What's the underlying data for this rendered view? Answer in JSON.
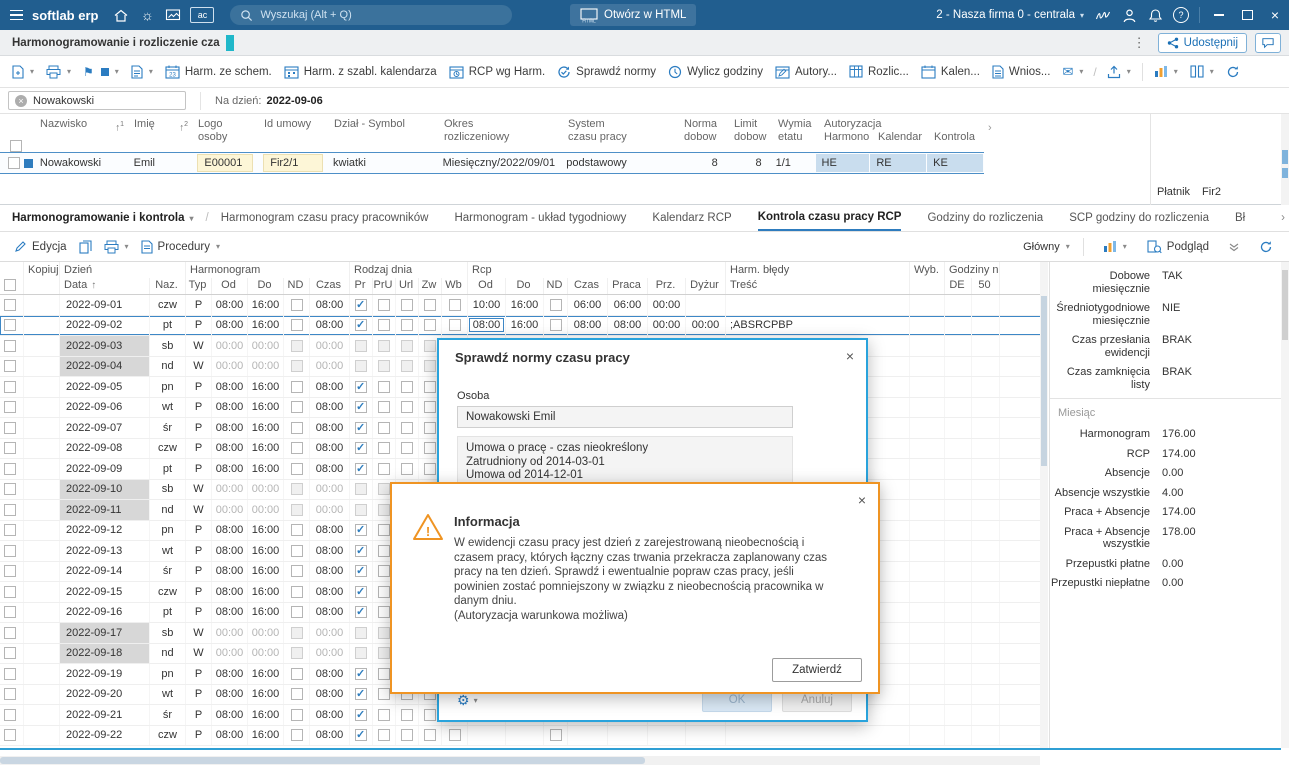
{
  "colors": {
    "accent_blue": "#2e7cbe",
    "topbar_blue": "#215e8f",
    "tab_marker_teal": "#1fb7c9",
    "dialog_orange": "#ef9423",
    "dialog_blue": "#29a3dc",
    "cell_yellow": "#fdf6d7",
    "cell_auth_blue": "#c9ddee"
  },
  "topbar": {
    "brand": "softlab erp",
    "search_placeholder": "Wyszukaj (Alt + Q)",
    "open_html": "Otwórz w HTML",
    "html_badge": "HTML",
    "company": "2 - Nasza firma 0 - centrala",
    "ac_badge": "ac"
  },
  "tabbar": {
    "tab": "Harmonogramowanie i rozliczenie cza",
    "share": "Udostępnij"
  },
  "toolbar": {
    "calendar_day": "23",
    "items": [
      {
        "label": "Harm. ze schem."
      },
      {
        "label": "Harm. z szabl. kalendarza"
      },
      {
        "label": "RCP wg Harm."
      },
      {
        "label": "Sprawdź normy"
      },
      {
        "label": "Wylicz godziny"
      },
      {
        "label": "Autory..."
      },
      {
        "label": "Rozlic..."
      },
      {
        "label": "Kalen..."
      },
      {
        "label": "Wnios..."
      }
    ]
  },
  "filters": {
    "chip": "Nowakowski",
    "date_label": "Na dzień:",
    "date_value": "2022-09-06"
  },
  "employee_table": {
    "headers": [
      {
        "l1": "Nazwisko",
        "l2": ""
      },
      {
        "l1": "Imię",
        "l2": ""
      },
      {
        "l1": "Logo",
        "l2": "osoby"
      },
      {
        "l1": "Id umowy",
        "l2": ""
      },
      {
        "l1": "Dział - Symbol",
        "l2": ""
      },
      {
        "l1": "Okres",
        "l2": "rozliczeniowy"
      },
      {
        "l1": "System",
        "l2": "czasu pracy"
      },
      {
        "l1": "Norma",
        "l2": "dobow"
      },
      {
        "l1": "Limit",
        "l2": "dobow"
      },
      {
        "l1": "Wymia",
        "l2": "etatu"
      },
      {
        "l1": "Autoryzacja",
        "l2": ""
      }
    ],
    "auth_subheaders": [
      "Harmono",
      "Kalendar",
      "Kontrola"
    ],
    "sort_indicators": [
      "1",
      "2"
    ],
    "row": {
      "nazwisko": "Nowakowski",
      "imie": "Emil",
      "logo": "E00001",
      "id_umowy": "Fir2/1",
      "dzial": "kwiatki",
      "okres": "Miesięczny/2022/09/01",
      "system": "podstawowy",
      "norma": "8",
      "limit": "8",
      "wymiar": "1/1",
      "aut_harm": "HE",
      "aut_kal": "RE",
      "aut_kon": "KE"
    },
    "platnik_label": "Płatnik",
    "platnik_value": "Fir2"
  },
  "view_tabs": {
    "context": "Harmonogramowanie i kontrola",
    "tabs": [
      "Harmonogram czasu pracy pracowników",
      "Harmonogram - układ tygodniowy",
      "Kalendarz RCP",
      "Kontrola czasu pracy RCP",
      "Godziny do rozliczenia",
      "SCP godziny do rozliczenia",
      "Bł"
    ],
    "active": "Kontrola czasu pracy RCP"
  },
  "subtoolbar": {
    "edycja": "Edycja",
    "procedury": "Procedury",
    "glowny": "Główny",
    "podglad": "Podgląd"
  },
  "detail_table": {
    "group_headers": [
      "Kopiuj",
      "Dzień",
      "Harmonogram",
      "Rodzaj dnia",
      "Rcp",
      "Harm. błędy",
      "Wyb.",
      "Godziny nad"
    ],
    "col_headers": [
      "Data",
      "Naz.",
      "Typ",
      "Od",
      "Do",
      "ND",
      "Czas",
      "Pr",
      "PrU",
      "Url",
      "Zw",
      "Wb",
      "Od",
      "Do",
      "ND",
      "Czas",
      "Praca",
      "Prz.",
      "Dyżur",
      "Treść",
      "DE",
      "50"
    ],
    "rows": [
      {
        "date": "2022-09-01",
        "day": "czw",
        "typ": "P",
        "od": "08:00",
        "do": "16:00",
        "nd": false,
        "czas": "08:00",
        "pr": true,
        "pru": false,
        "url": false,
        "zw": false,
        "wb": false,
        "rcp_od": "10:00",
        "rcp_do": "16:00",
        "rcp_nd": false,
        "rcp_czas": "06:00",
        "praca": "06:00",
        "prz": "00:00",
        "dyzur": "",
        "tresc": "",
        "de": "",
        "c50": "",
        "weekend": false,
        "selected": false
      },
      {
        "date": "2022-09-02",
        "day": "pt",
        "typ": "P",
        "od": "08:00",
        "do": "16:00",
        "nd": false,
        "czas": "08:00",
        "pr": true,
        "pru": false,
        "url": false,
        "zw": false,
        "wb": false,
        "rcp_od": "08:00",
        "rcp_do": "16:00",
        "rcp_nd": false,
        "rcp_czas": "08:00",
        "praca": "08:00",
        "prz": "00:00",
        "dyzur": "00:00",
        "tresc": ";ABSRCPBP",
        "de": "",
        "c50": "",
        "weekend": false,
        "selected": true
      },
      {
        "date": "2022-09-03",
        "day": "sb",
        "typ": "W",
        "od": "00:00",
        "do": "00:00",
        "nd": false,
        "czas": "00:00",
        "pr": false,
        "pru": false,
        "url": false,
        "zw": false,
        "wb": false,
        "rcp_od": "",
        "rcp_do": "",
        "rcp_nd": false,
        "rcp_czas": "",
        "praca": "",
        "prz": "",
        "dyzur": "",
        "tresc": "",
        "de": "",
        "c50": "",
        "weekend": true,
        "selected": false
      },
      {
        "date": "2022-09-04",
        "day": "nd",
        "typ": "W",
        "od": "00:00",
        "do": "00:00",
        "nd": false,
        "czas": "00:00",
        "pr": false,
        "pru": false,
        "url": false,
        "zw": false,
        "wb": false,
        "rcp_od": "",
        "rcp_do": "",
        "rcp_nd": false,
        "rcp_czas": "",
        "praca": "",
        "prz": "",
        "dyzur": "",
        "tresc": "",
        "de": "",
        "c50": "",
        "weekend": true,
        "selected": false
      },
      {
        "date": "2022-09-05",
        "day": "pn",
        "typ": "P",
        "od": "08:00",
        "do": "16:00",
        "nd": false,
        "czas": "08:00",
        "pr": true,
        "pru": false,
        "url": false,
        "zw": false,
        "wb": false,
        "rcp_od": "",
        "rcp_do": "",
        "rcp_nd": false,
        "rcp_czas": "",
        "praca": "",
        "prz": "",
        "dyzur": "",
        "tresc": "",
        "de": "",
        "c50": "",
        "weekend": false,
        "selected": false
      },
      {
        "date": "2022-09-06",
        "day": "wt",
        "typ": "P",
        "od": "08:00",
        "do": "16:00",
        "nd": false,
        "czas": "08:00",
        "pr": true,
        "pru": false,
        "url": false,
        "zw": false,
        "wb": false,
        "rcp_od": "",
        "rcp_do": "",
        "rcp_nd": false,
        "rcp_czas": "",
        "praca": "",
        "prz": "",
        "dyzur": "",
        "tresc": "",
        "de": "",
        "c50": "",
        "weekend": false,
        "selected": false
      },
      {
        "date": "2022-09-07",
        "day": "śr",
        "typ": "P",
        "od": "08:00",
        "do": "16:00",
        "nd": false,
        "czas": "08:00",
        "pr": true,
        "pru": false,
        "url": false,
        "zw": false,
        "wb": false,
        "rcp_od": "",
        "rcp_do": "",
        "rcp_nd": false,
        "rcp_czas": "",
        "praca": "",
        "prz": "",
        "dyzur": "",
        "tresc": "",
        "de": "",
        "c50": "",
        "weekend": false,
        "selected": false
      },
      {
        "date": "2022-09-08",
        "day": "czw",
        "typ": "P",
        "od": "08:00",
        "do": "16:00",
        "nd": false,
        "czas": "08:00",
        "pr": true,
        "pru": false,
        "url": false,
        "zw": false,
        "wb": false,
        "rcp_od": "",
        "rcp_do": "",
        "rcp_nd": false,
        "rcp_czas": "",
        "praca": "",
        "prz": "",
        "dyzur": "",
        "tresc": "",
        "de": "",
        "c50": "",
        "weekend": false,
        "selected": false
      },
      {
        "date": "2022-09-09",
        "day": "pt",
        "typ": "P",
        "od": "08:00",
        "do": "16:00",
        "nd": false,
        "czas": "08:00",
        "pr": true,
        "pru": false,
        "url": false,
        "zw": false,
        "wb": false,
        "rcp_od": "",
        "rcp_do": "",
        "rcp_nd": false,
        "rcp_czas": "",
        "praca": "",
        "prz": "",
        "dyzur": "",
        "tresc": "",
        "de": "",
        "c50": "",
        "weekend": false,
        "selected": false
      },
      {
        "date": "2022-09-10",
        "day": "sb",
        "typ": "W",
        "od": "00:00",
        "do": "00:00",
        "nd": false,
        "czas": "00:00",
        "pr": false,
        "pru": false,
        "url": false,
        "zw": false,
        "wb": false,
        "rcp_od": "",
        "rcp_do": "",
        "rcp_nd": false,
        "rcp_czas": "",
        "praca": "",
        "prz": "",
        "dyzur": "",
        "tresc": "",
        "de": "",
        "c50": "",
        "weekend": true,
        "selected": false
      },
      {
        "date": "2022-09-11",
        "day": "nd",
        "typ": "W",
        "od": "00:00",
        "do": "00:00",
        "nd": false,
        "czas": "00:00",
        "pr": false,
        "pru": false,
        "url": false,
        "zw": false,
        "wb": false,
        "rcp_od": "",
        "rcp_do": "",
        "rcp_nd": false,
        "rcp_czas": "",
        "praca": "",
        "prz": "",
        "dyzur": "",
        "tresc": "",
        "de": "",
        "c50": "",
        "weekend": true,
        "selected": false
      },
      {
        "date": "2022-09-12",
        "day": "pn",
        "typ": "P",
        "od": "08:00",
        "do": "16:00",
        "nd": false,
        "czas": "08:00",
        "pr": true,
        "pru": false,
        "url": false,
        "zw": false,
        "wb": false,
        "rcp_od": "",
        "rcp_do": "",
        "rcp_nd": false,
        "rcp_czas": "",
        "praca": "",
        "prz": "",
        "dyzur": "",
        "tresc": "",
        "de": "",
        "c50": "",
        "weekend": false,
        "selected": false
      },
      {
        "date": "2022-09-13",
        "day": "wt",
        "typ": "P",
        "od": "08:00",
        "do": "16:00",
        "nd": false,
        "czas": "08:00",
        "pr": true,
        "pru": false,
        "url": false,
        "zw": false,
        "wb": false,
        "rcp_od": "",
        "rcp_do": "",
        "rcp_nd": false,
        "rcp_czas": "",
        "praca": "",
        "prz": "",
        "dyzur": "",
        "tresc": "",
        "de": "",
        "c50": "",
        "weekend": false,
        "selected": false
      },
      {
        "date": "2022-09-14",
        "day": "śr",
        "typ": "P",
        "od": "08:00",
        "do": "16:00",
        "nd": false,
        "czas": "08:00",
        "pr": true,
        "pru": false,
        "url": false,
        "zw": false,
        "wb": false,
        "rcp_od": "",
        "rcp_do": "",
        "rcp_nd": false,
        "rcp_czas": "",
        "praca": "",
        "prz": "",
        "dyzur": "",
        "tresc": "",
        "de": "",
        "c50": "",
        "weekend": false,
        "selected": false
      },
      {
        "date": "2022-09-15",
        "day": "czw",
        "typ": "P",
        "od": "08:00",
        "do": "16:00",
        "nd": false,
        "czas": "08:00",
        "pr": true,
        "pru": false,
        "url": false,
        "zw": false,
        "wb": false,
        "rcp_od": "",
        "rcp_do": "",
        "rcp_nd": false,
        "rcp_czas": "",
        "praca": "",
        "prz": "",
        "dyzur": "",
        "tresc": "",
        "de": "",
        "c50": "",
        "weekend": false,
        "selected": false
      },
      {
        "date": "2022-09-16",
        "day": "pt",
        "typ": "P",
        "od": "08:00",
        "do": "16:00",
        "nd": false,
        "czas": "08:00",
        "pr": true,
        "pru": false,
        "url": false,
        "zw": false,
        "wb": false,
        "rcp_od": "",
        "rcp_do": "",
        "rcp_nd": false,
        "rcp_czas": "",
        "praca": "",
        "prz": "",
        "dyzur": "",
        "tresc": "",
        "de": "",
        "c50": "",
        "weekend": false,
        "selected": false
      },
      {
        "date": "2022-09-17",
        "day": "sb",
        "typ": "W",
        "od": "00:00",
        "do": "00:00",
        "nd": false,
        "czas": "00:00",
        "pr": false,
        "pru": false,
        "url": false,
        "zw": false,
        "wb": false,
        "rcp_od": "",
        "rcp_do": "",
        "rcp_nd": false,
        "rcp_czas": "",
        "praca": "",
        "prz": "",
        "dyzur": "",
        "tresc": "",
        "de": "",
        "c50": "",
        "weekend": true,
        "selected": false
      },
      {
        "date": "2022-09-18",
        "day": "nd",
        "typ": "W",
        "od": "00:00",
        "do": "00:00",
        "nd": false,
        "czas": "00:00",
        "pr": false,
        "pru": false,
        "url": false,
        "zw": false,
        "wb": false,
        "rcp_od": "",
        "rcp_do": "",
        "rcp_nd": false,
        "rcp_czas": "",
        "praca": "",
        "prz": "",
        "dyzur": "",
        "tresc": "",
        "de": "",
        "c50": "",
        "weekend": true,
        "selected": false
      },
      {
        "date": "2022-09-19",
        "day": "pn",
        "typ": "P",
        "od": "08:00",
        "do": "16:00",
        "nd": false,
        "czas": "08:00",
        "pr": true,
        "pru": false,
        "url": false,
        "zw": false,
        "wb": false,
        "rcp_od": "",
        "rcp_do": "",
        "rcp_nd": false,
        "rcp_czas": "",
        "praca": "",
        "prz": "",
        "dyzur": "",
        "tresc": "",
        "de": "",
        "c50": "",
        "weekend": false,
        "selected": false
      },
      {
        "date": "2022-09-20",
        "day": "wt",
        "typ": "P",
        "od": "08:00",
        "do": "16:00",
        "nd": false,
        "czas": "08:00",
        "pr": true,
        "pru": false,
        "url": false,
        "zw": false,
        "wb": false,
        "rcp_od": "",
        "rcp_do": "",
        "rcp_nd": false,
        "rcp_czas": "",
        "praca": "",
        "prz": "",
        "dyzur": "",
        "tresc": "",
        "de": "",
        "c50": "",
        "weekend": false,
        "selected": false
      },
      {
        "date": "2022-09-21",
        "day": "śr",
        "typ": "P",
        "od": "08:00",
        "do": "16:00",
        "nd": false,
        "czas": "08:00",
        "pr": true,
        "pru": false,
        "url": false,
        "zw": false,
        "wb": false,
        "rcp_od": "",
        "rcp_do": "",
        "rcp_nd": false,
        "rcp_czas": "",
        "praca": "",
        "prz": "",
        "dyzur": "",
        "tresc": "",
        "de": "",
        "c50": "",
        "weekend": false,
        "selected": false
      },
      {
        "date": "2022-09-22",
        "day": "czw",
        "typ": "P",
        "od": "08:00",
        "do": "16:00",
        "nd": false,
        "czas": "08:00",
        "pr": true,
        "pru": false,
        "url": false,
        "zw": false,
        "wb": false,
        "rcp_od": "",
        "rcp_do": "",
        "rcp_nd": false,
        "rcp_czas": "",
        "praca": "",
        "prz": "",
        "dyzur": "",
        "tresc": "",
        "de": "",
        "c50": "",
        "weekend": false,
        "selected": false
      }
    ]
  },
  "summary_panel": {
    "flags": [
      {
        "label": "Dobowe miesięcznie",
        "value": "TAK"
      },
      {
        "label": "Średniotygodniowe miesięcznie",
        "value": "NIE"
      },
      {
        "label": "Czas przesłania ewidencji",
        "value": "BRAK"
      },
      {
        "label": "Czas zamknięcia listy",
        "value": "BRAK"
      }
    ],
    "section": "Miesiąc",
    "stats": [
      {
        "label": "Harmonogram",
        "value": "176.00"
      },
      {
        "label": "RCP",
        "value": "174.00"
      },
      {
        "label": "Absencje",
        "value": "0.00"
      },
      {
        "label": "Absencje wszystkie",
        "value": "4.00"
      },
      {
        "label": "Praca + Absencje",
        "value": "174.00"
      },
      {
        "label": "Praca + Absencje wszystkie",
        "value": "178.00"
      },
      {
        "label": "Przepustki płatne",
        "value": "0.00"
      },
      {
        "label": "Przepustki niepłatne",
        "value": "0.00"
      }
    ]
  },
  "dialog_norms": {
    "title": "Sprawdź normy czasu pracy",
    "osoba_label": "Osoba",
    "person": "Nowakowski Emil",
    "contract_lines": [
      "Umowa o pracę - czas nieokreślony",
      "Zatrudniony od 2014-03-01",
      "Umowa od 2014-12-01"
    ],
    "ok": "OK",
    "cancel": "Anuluj"
  },
  "dialog_info": {
    "title": "Informacja",
    "body": "W ewidencji czasu pracy jest dzień z zarejestrowaną nieobecnością i czasem pracy, których łączny czas trwania przekracza zaplanowany czas pracy na ten dzień. Sprawdź i ewentualnie popraw czas pracy, jeśli powinien zostać pomniejszony w związku z nieobecnością pracownika w danym dniu.",
    "note": "(Autoryzacja warunkowa możliwa)",
    "confirm": "Zatwierdź"
  }
}
